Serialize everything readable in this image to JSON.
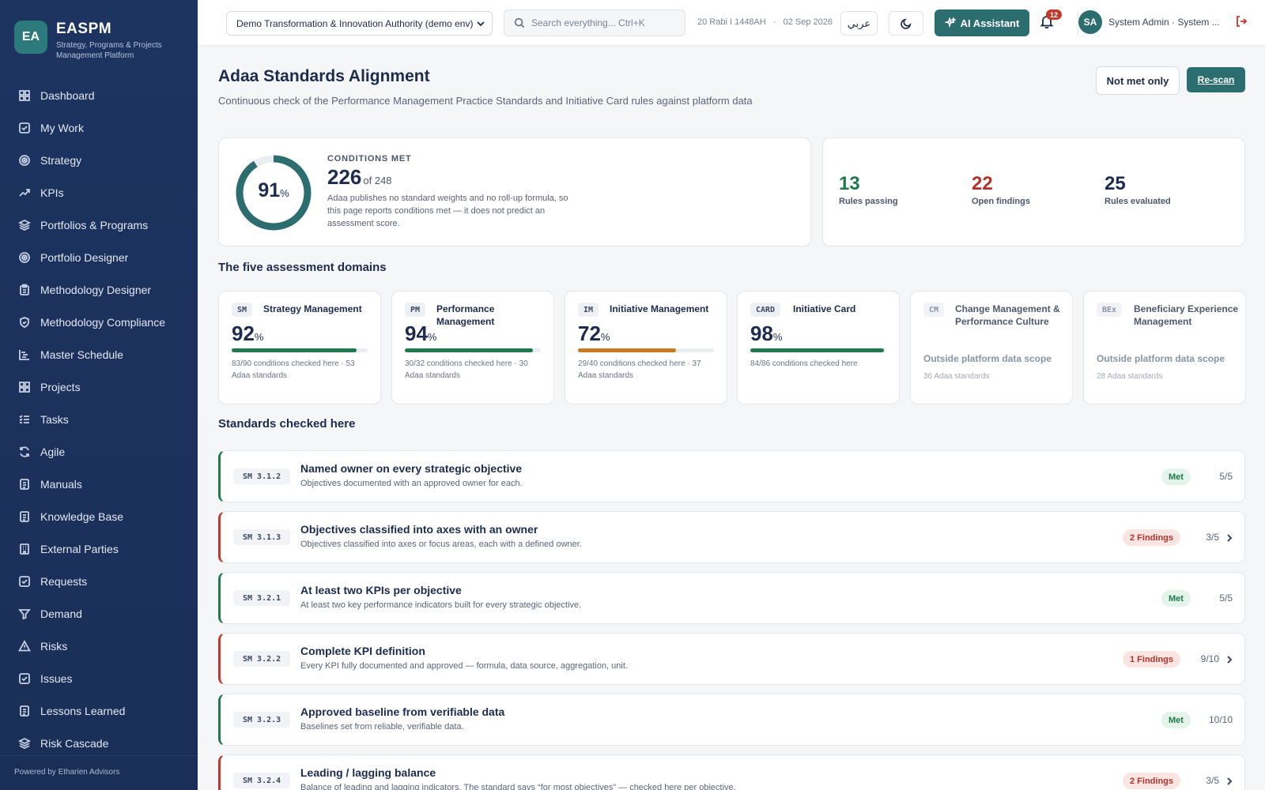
{
  "brand": {
    "logo": "EA",
    "name": "EASPM",
    "subtitle": "Strategy, Programs & Projects Management Platform",
    "footer": "Powered by Etharien Advisors"
  },
  "nav": [
    {
      "label": "Dashboard",
      "icon": "dashboard-icon"
    },
    {
      "label": "My Work",
      "icon": "check-square-icon"
    },
    {
      "label": "Strategy",
      "icon": "target-icon"
    },
    {
      "label": "KPIs",
      "icon": "trend-up-icon"
    },
    {
      "label": "Portfolios & Programs",
      "icon": "layers-icon"
    },
    {
      "label": "Portfolio Designer",
      "icon": "target-icon"
    },
    {
      "label": "Methodology Designer",
      "icon": "clipboard-icon"
    },
    {
      "label": "Methodology Compliance",
      "icon": "shield-icon"
    },
    {
      "label": "Master Schedule",
      "icon": "gantt-icon"
    },
    {
      "label": "Projects",
      "icon": "grid-icon"
    },
    {
      "label": "Tasks",
      "icon": "list-check-icon"
    },
    {
      "label": "Agile",
      "icon": "refresh-icon"
    },
    {
      "label": "Manuals",
      "icon": "document-icon"
    },
    {
      "label": "Knowledge Base",
      "icon": "document-icon"
    },
    {
      "label": "External Parties",
      "icon": "building-icon"
    },
    {
      "label": "Requests",
      "icon": "check-square-icon"
    },
    {
      "label": "Demand",
      "icon": "funnel-icon"
    },
    {
      "label": "Risks",
      "icon": "warning-icon"
    },
    {
      "label": "Issues",
      "icon": "check-square-icon"
    },
    {
      "label": "Lessons Learned",
      "icon": "document-icon"
    },
    {
      "label": "Risk Cascade",
      "icon": "layers-icon"
    }
  ],
  "topbar": {
    "org": "Demo Transformation & Innovation Authority (demo env)",
    "search_placeholder": "Search everything... Ctrl+K",
    "date_hijri": "20 Rabi I 1448AH",
    "date_sep": "·",
    "date_greg": "02 Sep 2026",
    "lang": "عربي",
    "ai_label": "AI Assistant",
    "notifications": "12",
    "avatar": "SA",
    "user": "System Admin · System ..."
  },
  "page": {
    "title": "Adaa Standards Alignment",
    "subtitle": "Continuous check of the Performance Management Practice Standards and Initiative Card rules against platform data",
    "btn_not_met": "Not met only",
    "btn_rescan": "Re-scan"
  },
  "summary": {
    "percent": "91",
    "percent_value": 91,
    "pct_sign": "%",
    "label": "CONDITIONS MET",
    "met": "226",
    "of_total": "of 248",
    "note": "Adaa publishes no standard weights and no roll-up formula, so this page reports conditions met — it does not predict an assessment score."
  },
  "stats": [
    {
      "value": "13",
      "label": "Rules passing",
      "color": "#1e7a4c"
    },
    {
      "value": "22",
      "label": "Open findings",
      "color": "#b3332a"
    },
    {
      "value": "25",
      "label": "Rules evaluated",
      "color": "#1d2b4f"
    }
  ],
  "domains_title": "The five assessment domains",
  "domains": [
    {
      "tag": "SM",
      "name": "Strategy Management",
      "pct": "92",
      "pct_value": 92,
      "color": "#1e7a4c",
      "note": "83/90 conditions checked here · 53 Adaa standards"
    },
    {
      "tag": "PM",
      "name": "Performance Management",
      "pct": "94",
      "pct_value": 94,
      "color": "#1e7a4c",
      "note": "30/32 conditions checked here · 30 Adaa standards"
    },
    {
      "tag": "IM",
      "name": "Initiative Management",
      "pct": "72",
      "pct_value": 72,
      "color": "#c77a1e",
      "note": "29/40 conditions checked here · 37 Adaa standards"
    },
    {
      "tag": "CARD",
      "name": "Initiative Card",
      "pct": "98",
      "pct_value": 98,
      "color": "#1e7a4c",
      "note": "84/86 conditions checked here"
    },
    {
      "tag": "CM",
      "name": "Change Management & Performance Culture",
      "outside": "Outside platform data scope",
      "note": "36 Adaa standards"
    },
    {
      "tag": "BEx",
      "name": "Beneficiary Experience Management",
      "outside": "Outside platform data scope",
      "note": "28 Adaa standards"
    }
  ],
  "standards_title": "Standards checked here",
  "standards": [
    {
      "code": "SM 3.1.2",
      "title": "Named owner on every strategic objective",
      "desc": "Objectives documented with an approved owner for each.",
      "status": "Met",
      "ratio": "5/5"
    },
    {
      "code": "SM 3.1.3",
      "title": "Objectives classified into axes with an owner",
      "desc": "Objectives classified into axes or focus areas, each with a defined owner.",
      "status": "2 Findings",
      "ratio": "3/5"
    },
    {
      "code": "SM 3.2.1",
      "title": "At least two KPIs per objective",
      "desc": "At least two key performance indicators built for every strategic objective.",
      "status": "Met",
      "ratio": "5/5"
    },
    {
      "code": "SM 3.2.2",
      "title": "Complete KPI definition",
      "desc": "Every KPI fully documented and approved — formula, data source, aggregation, unit.",
      "status": "1 Findings",
      "ratio": "9/10"
    },
    {
      "code": "SM 3.2.3",
      "title": "Approved baseline from verifiable data",
      "desc": "Baselines set from reliable, verifiable data.",
      "status": "Met",
      "ratio": "10/10"
    },
    {
      "code": "SM 3.2.4",
      "title": "Leading / lagging balance",
      "desc": "Balance of leading and lagging indicators. The standard says “for most objectives” — checked here per objective.",
      "status": "2 Findings",
      "ratio": "3/5"
    }
  ]
}
